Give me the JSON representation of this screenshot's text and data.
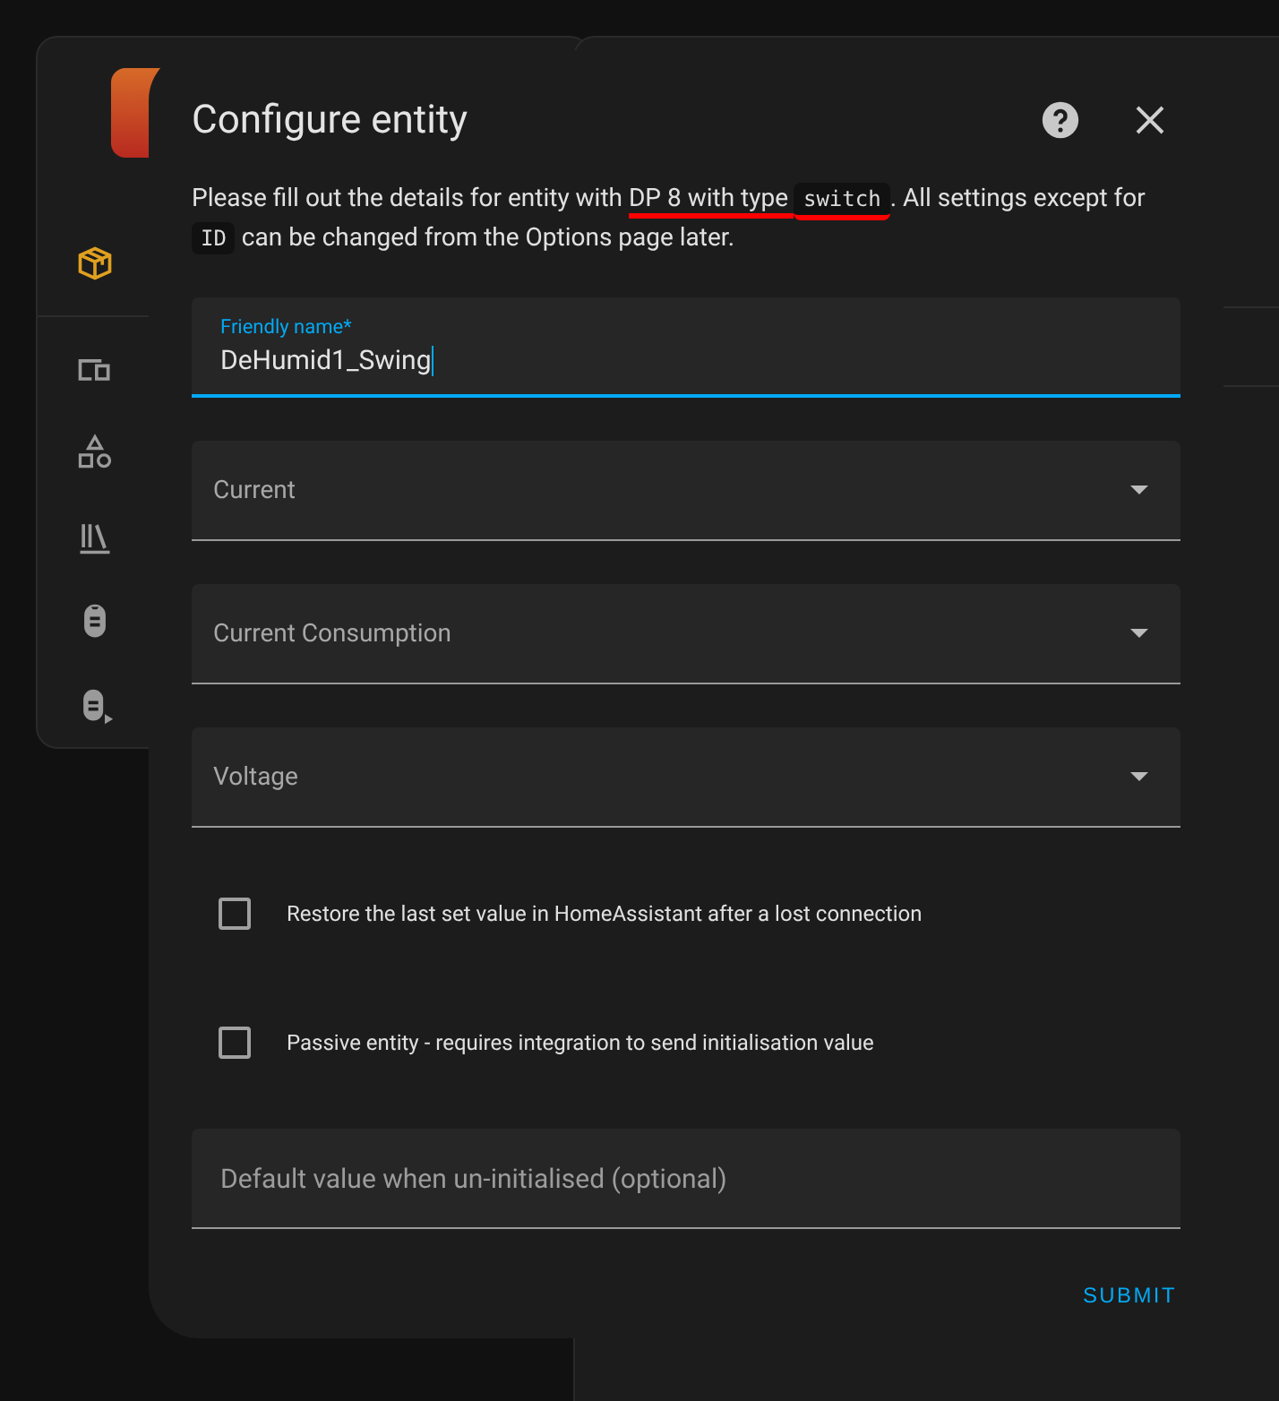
{
  "dialog": {
    "title": "Configure entity",
    "description": [
      {
        "kind": "text",
        "text": "Please fill out the details for entity with ",
        "highlighted": false
      },
      {
        "kind": "text",
        "text": "DP 8 with type ",
        "highlighted": true
      },
      {
        "kind": "code",
        "text": "switch",
        "highlighted": true
      },
      {
        "kind": "text",
        "text": ". All settings except for ",
        "highlighted": false
      },
      {
        "kind": "code",
        "text": "ID",
        "highlighted": false
      },
      {
        "kind": "text",
        "text": " can be changed from the Options page later.",
        "highlighted": false
      }
    ],
    "fields": [
      {
        "kind": "text",
        "label": "Friendly name*",
        "value": "DeHumid1_Swing",
        "focused": true
      },
      {
        "kind": "select",
        "label": "Current"
      },
      {
        "kind": "select",
        "label": "Current Consumption"
      },
      {
        "kind": "select",
        "label": "Voltage"
      },
      {
        "kind": "checkbox",
        "label": "Restore the last set value in HomeAssistant after a lost connection",
        "checked": false
      },
      {
        "kind": "checkbox",
        "label": "Passive entity - requires integration to send initialisation value",
        "checked": false
      },
      {
        "kind": "text",
        "placeholder": "Default value when un-initialised (optional)",
        "focused": false
      }
    ],
    "submit": "SUBMIT"
  }
}
